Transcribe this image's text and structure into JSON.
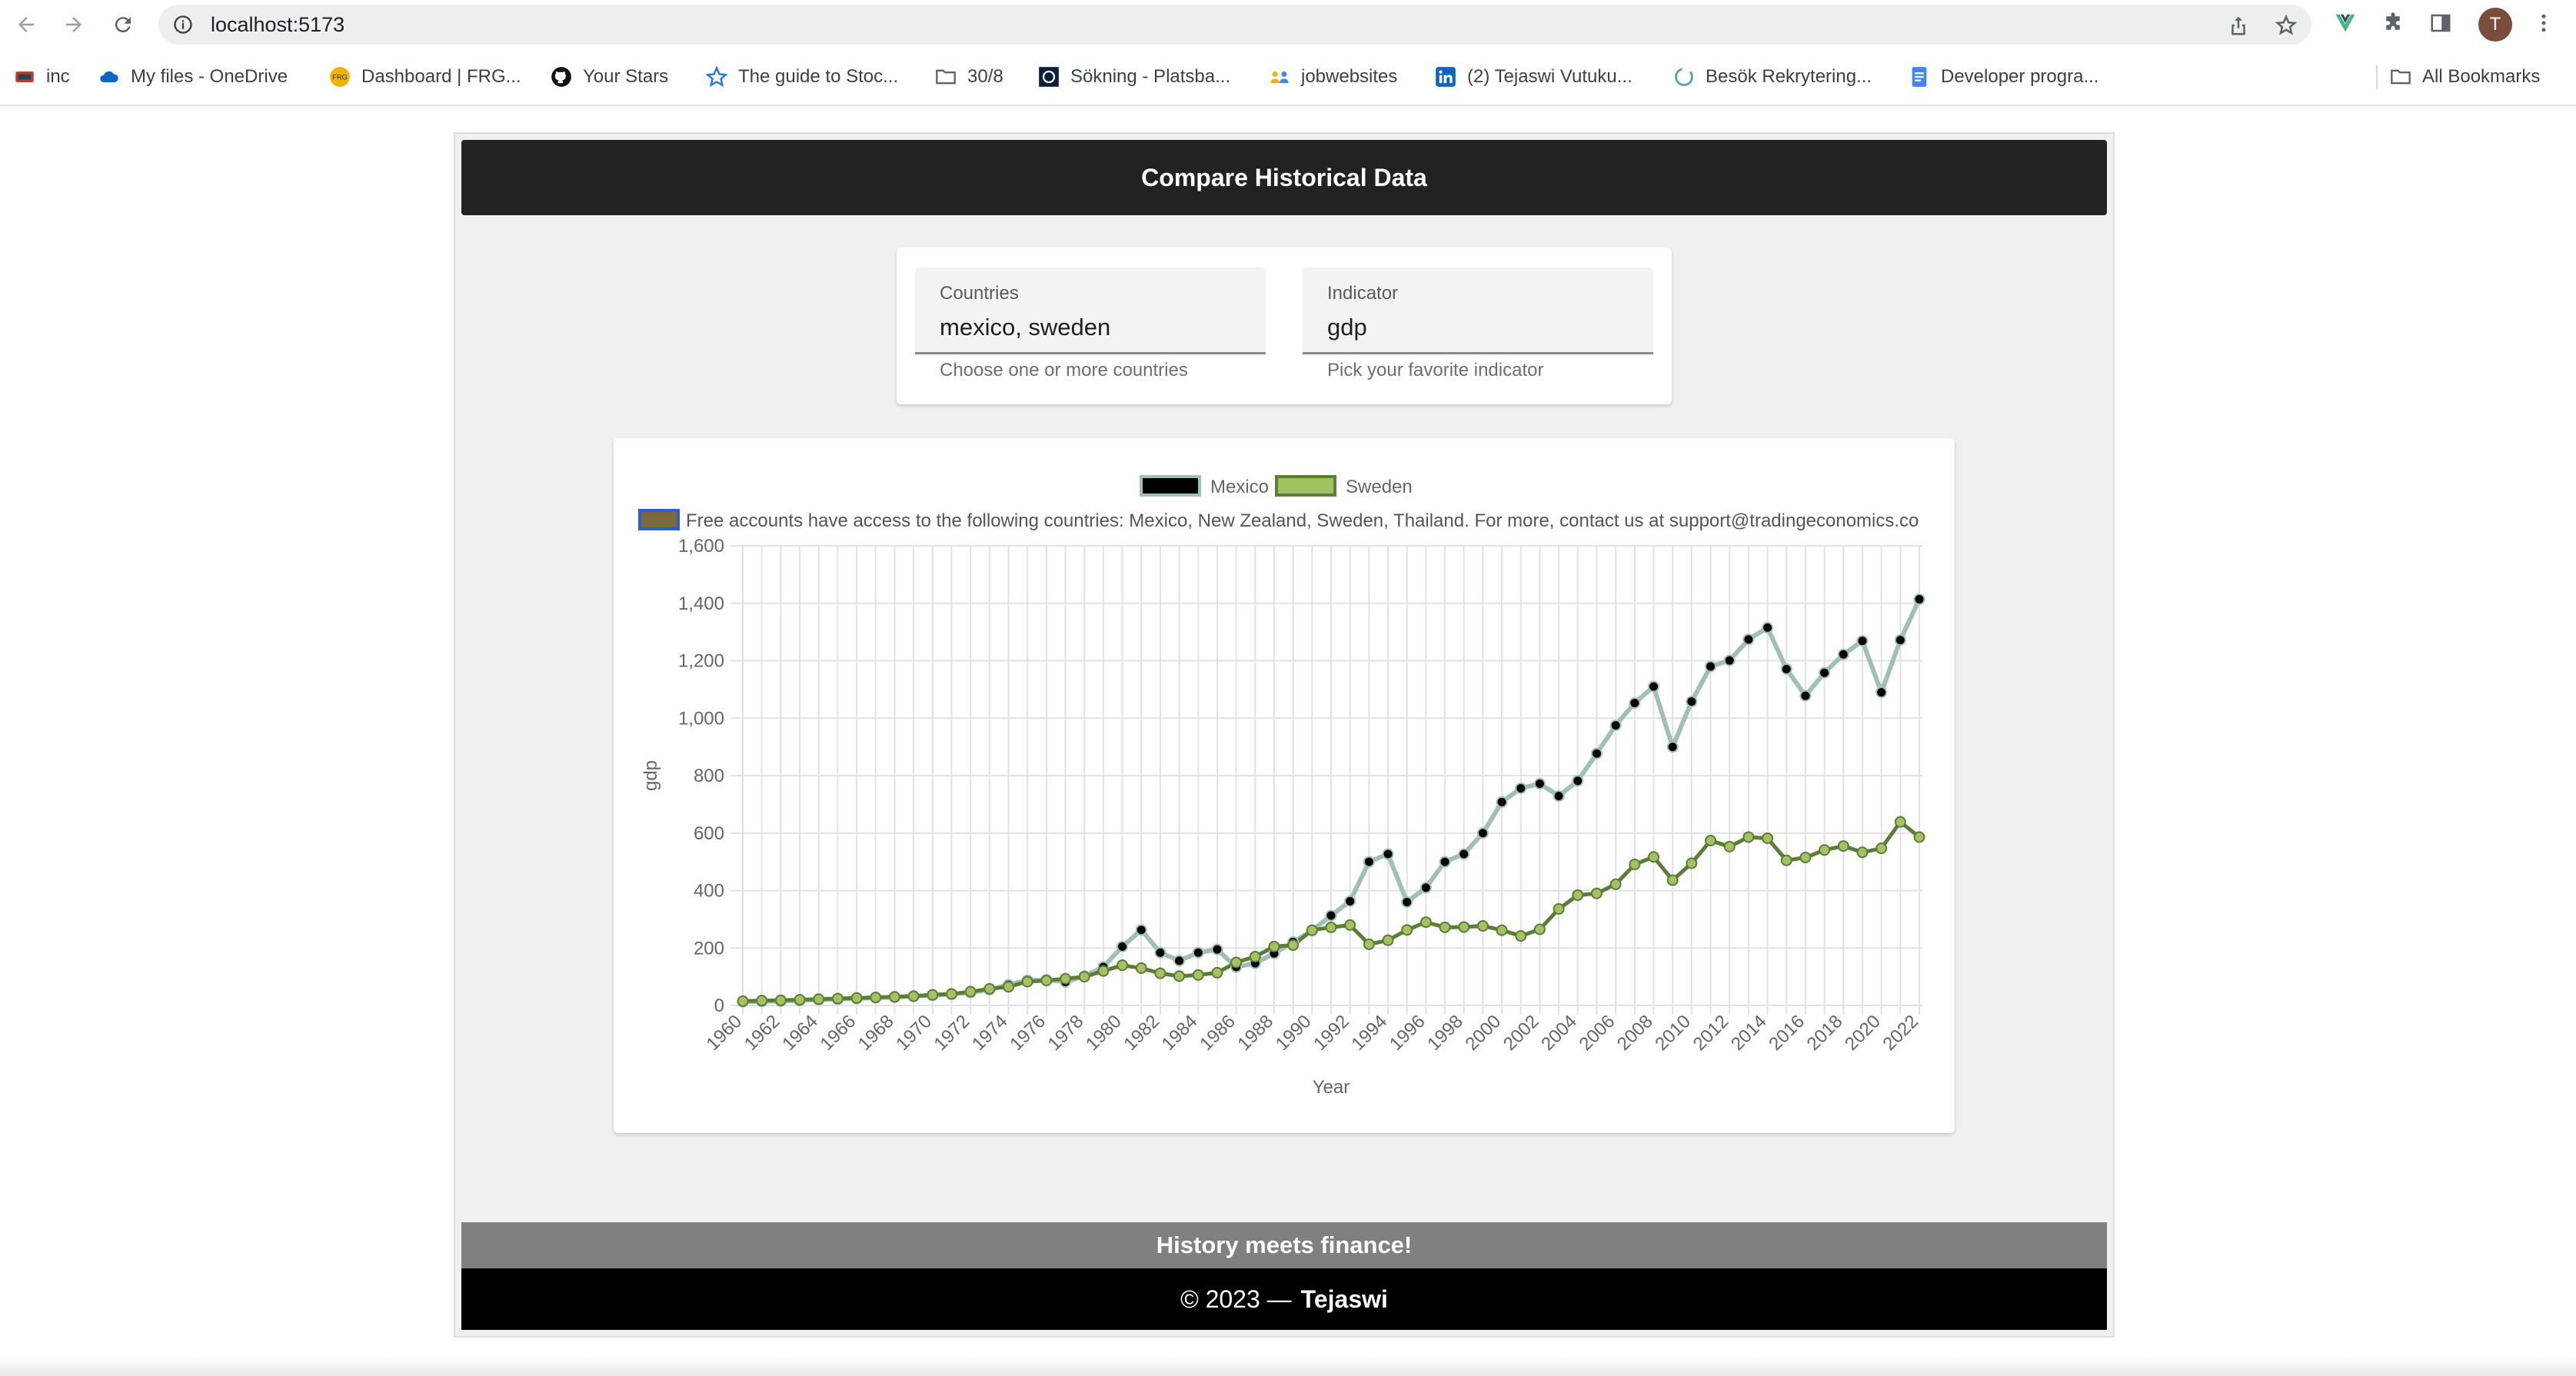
{
  "browser": {
    "url": "localhost:5173",
    "avatar_letter": "T",
    "bookmarks": [
      {
        "label": "inc",
        "icon": "inc-icon"
      },
      {
        "label": "My files - OneDrive",
        "icon": "onedrive-icon"
      },
      {
        "label": "Dashboard | FRG...",
        "icon": "frg-icon"
      },
      {
        "label": "Your Stars",
        "icon": "github-icon"
      },
      {
        "label": "The guide to Stoc...",
        "icon": "star-icon"
      },
      {
        "label": "30/8",
        "icon": "folder-icon"
      },
      {
        "label": "Sökning - Platsba...",
        "icon": "platsbanken-icon"
      },
      {
        "label": "jobwebsites",
        "icon": "people-icon"
      },
      {
        "label": "(2) Tejaswi Vutuku...",
        "icon": "linkedin-icon"
      },
      {
        "label": "Besök Rekrytering...",
        "icon": "circle-icon"
      },
      {
        "label": "Developer progra...",
        "icon": "doc-icon"
      }
    ],
    "all_bookmarks": "All Bookmarks"
  },
  "header": {
    "title": "Compare Historical Data"
  },
  "form": {
    "countries": {
      "label": "Countries",
      "value": "mexico, sweden",
      "hint": "Choose one or more countries"
    },
    "indicator": {
      "label": "Indicator",
      "value": "gdp",
      "hint": "Pick your favorite indicator"
    }
  },
  "chart_data": {
    "type": "line",
    "xlabel": "Year",
    "ylabel": "gdp",
    "ylim": [
      0,
      1600
    ],
    "yticks": [
      "0",
      "200",
      "400",
      "600",
      "800",
      "1,000",
      "1,200",
      "1,400",
      "1,600"
    ],
    "x": [
      1960,
      1961,
      1962,
      1963,
      1964,
      1965,
      1966,
      1967,
      1968,
      1969,
      1970,
      1971,
      1972,
      1973,
      1974,
      1975,
      1976,
      1977,
      1978,
      1979,
      1980,
      1981,
      1982,
      1983,
      1984,
      1985,
      1986,
      1987,
      1988,
      1989,
      1990,
      1991,
      1992,
      1993,
      1994,
      1995,
      1996,
      1997,
      1998,
      1999,
      2000,
      2001,
      2002,
      2003,
      2004,
      2005,
      2006,
      2007,
      2008,
      2009,
      2010,
      2011,
      2012,
      2013,
      2014,
      2015,
      2016,
      2017,
      2018,
      2019,
      2020,
      2021,
      2022
    ],
    "xtick_labels": [
      "1960",
      "1962",
      "1964",
      "1966",
      "1968",
      "1970",
      "1972",
      "1974",
      "1976",
      "1978",
      "1980",
      "1982",
      "1984",
      "1986",
      "1988",
      "1990",
      "1992",
      "1994",
      "1996",
      "1998",
      "2000",
      "2002",
      "2004",
      "2006",
      "2008",
      "2010",
      "2012",
      "2014",
      "2016",
      "2018",
      "2020",
      "2022"
    ],
    "legend": [
      "Mexico",
      "Sweden"
    ],
    "notice": "Free accounts have access to the following countries: Mexico, New Zealand, Sweden, Thailand. For more, contact us at support@tradingeconomics.co",
    "series": [
      {
        "name": "Mexico",
        "line_color": "#9fc1b4",
        "point_color": "#000000",
        "values": [
          13,
          14,
          15,
          17,
          20,
          22,
          24,
          27,
          29,
          33,
          35,
          39,
          45,
          55,
          72,
          88,
          89,
          82,
          102,
          134,
          205,
          263,
          184,
          156,
          184,
          195,
          134,
          147,
          181,
          221,
          261,
          313,
          363,
          500,
          527,
          360,
          410,
          500,
          527,
          600,
          708,
          756,
          772,
          729,
          782,
          877,
          975,
          1053,
          1110,
          900,
          1058,
          1180,
          1201,
          1274,
          1315,
          1171,
          1078,
          1158,
          1222,
          1269,
          1090,
          1272,
          1414
        ]
      },
      {
        "name": "Sweden",
        "line_color": "#5a7d3a",
        "point_color": "#a5c25e",
        "values": [
          15,
          17,
          18,
          20,
          22,
          24,
          26,
          28,
          30,
          32,
          37,
          40,
          48,
          58,
          65,
          83,
          87,
          93,
          100,
          120,
          140,
          130,
          112,
          102,
          106,
          114,
          150,
          170,
          205,
          210,
          262,
          272,
          280,
          213,
          227,
          263,
          290,
          272,
          273,
          277,
          262,
          242,
          265,
          336,
          384,
          390,
          422,
          491,
          517,
          436,
          495,
          574,
          553,
          586,
          582,
          505,
          515,
          541,
          555,
          533,
          547,
          639,
          586
        ]
      }
    ]
  },
  "footer": {
    "tagline": "History meets finance!",
    "copyright": "© 2023 —",
    "author": "Tejaswi"
  }
}
